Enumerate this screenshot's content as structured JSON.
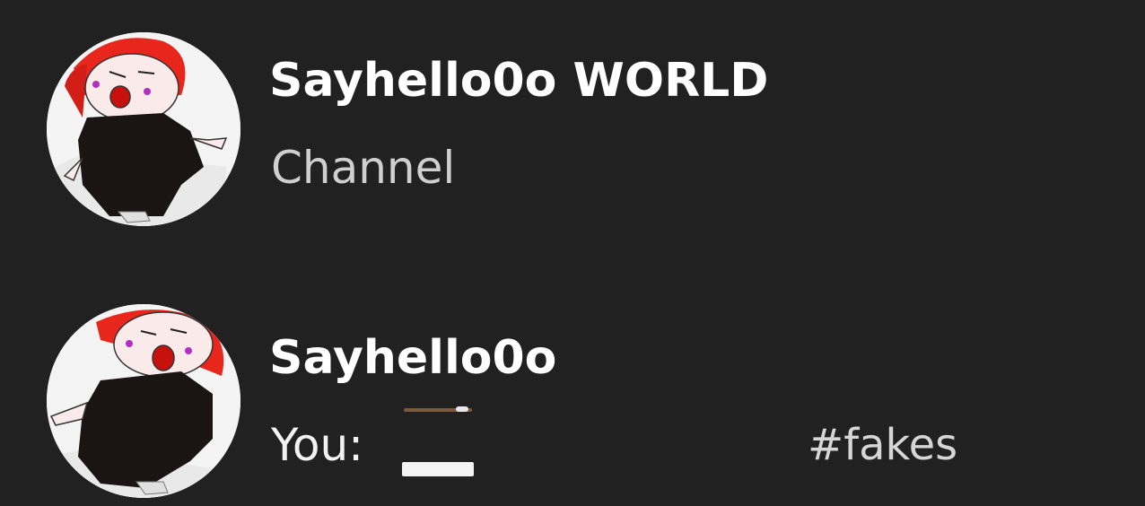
{
  "results": [
    {
      "title": "Sayhello0o WORLD",
      "subtitle": "Channel",
      "avatar_icon": "cartoon-girl-avatar"
    },
    {
      "title": "Sayhello0o",
      "subtitle": "You:",
      "tag": "#fakes",
      "avatar_icon": "cartoon-girl-avatar"
    }
  ],
  "colors": {
    "background": "#212121",
    "title": "#ffffff",
    "subtitle_channel": "#cfcfcf",
    "tag": "#d6d6d6",
    "hair": "#e8261c",
    "dress": "#1a1415"
  }
}
